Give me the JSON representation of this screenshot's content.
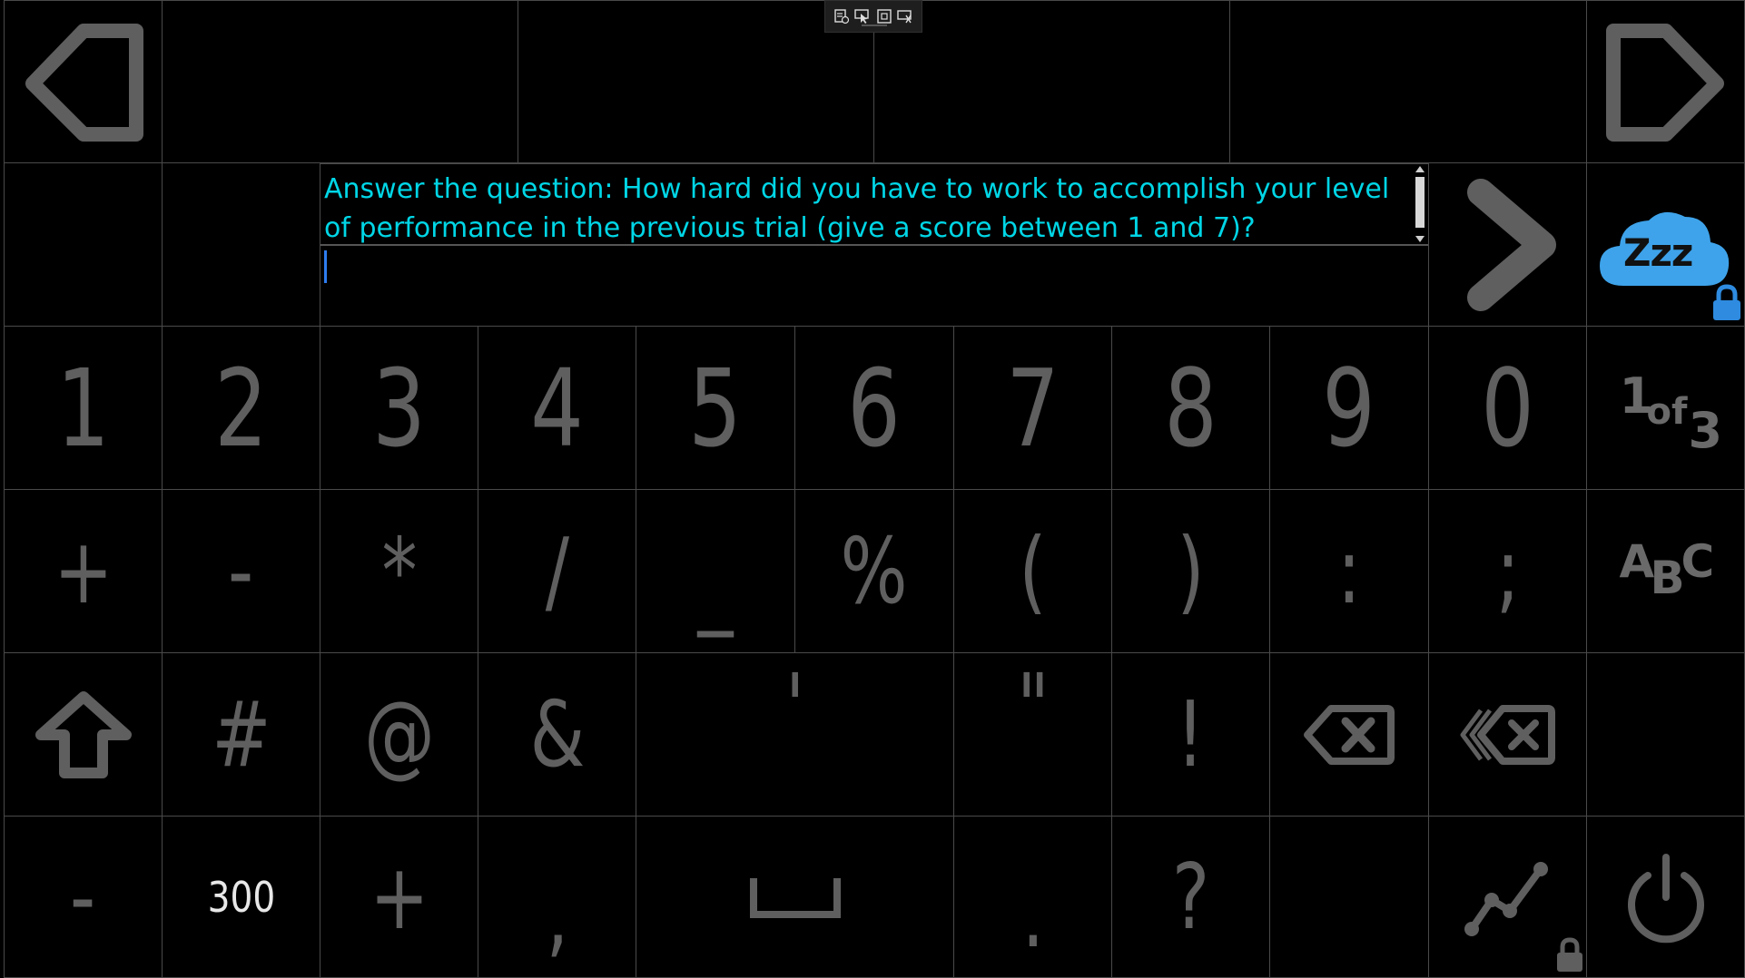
{
  "toolbar": {
    "icons": [
      "settings-icon",
      "pointer-icon",
      "window-icon",
      "move-icon"
    ]
  },
  "question": {
    "text": "Answer the question: How hard did you have to work to accomplish your level of performance in the previous trial (give a score between 1 and 7)?",
    "input_value": ""
  },
  "keyboard": {
    "digits": [
      "1",
      "2",
      "3",
      "4",
      "5",
      "6",
      "7",
      "8",
      "9",
      "0"
    ],
    "page_indicator": {
      "current": "1",
      "of": "of",
      "total": "3"
    },
    "row_symbols_1": [
      "+",
      "-",
      "*",
      "/",
      "_",
      "%",
      "(",
      ")",
      ":",
      ";"
    ],
    "abc_label": {
      "a": "A",
      "b": "B",
      "c": "C"
    },
    "row_symbols_2": [
      "#",
      "@",
      "&",
      "=",
      "'",
      "\"",
      "!"
    ],
    "bottom_row": {
      "minus": "-",
      "value": "300",
      "plus": "+",
      "comma": ",",
      "period": ".",
      "question_mark": "?"
    }
  },
  "sleep_button": {
    "label": "Zzz"
  },
  "colors": {
    "background": "#000000",
    "grid_line": "#4a4a4a",
    "key_text": "#5f5f5f",
    "question_text": "#00d6e6",
    "caret": "#2e7cf0",
    "cloud": "#3ea3ea",
    "lock": "#2e8be0"
  }
}
